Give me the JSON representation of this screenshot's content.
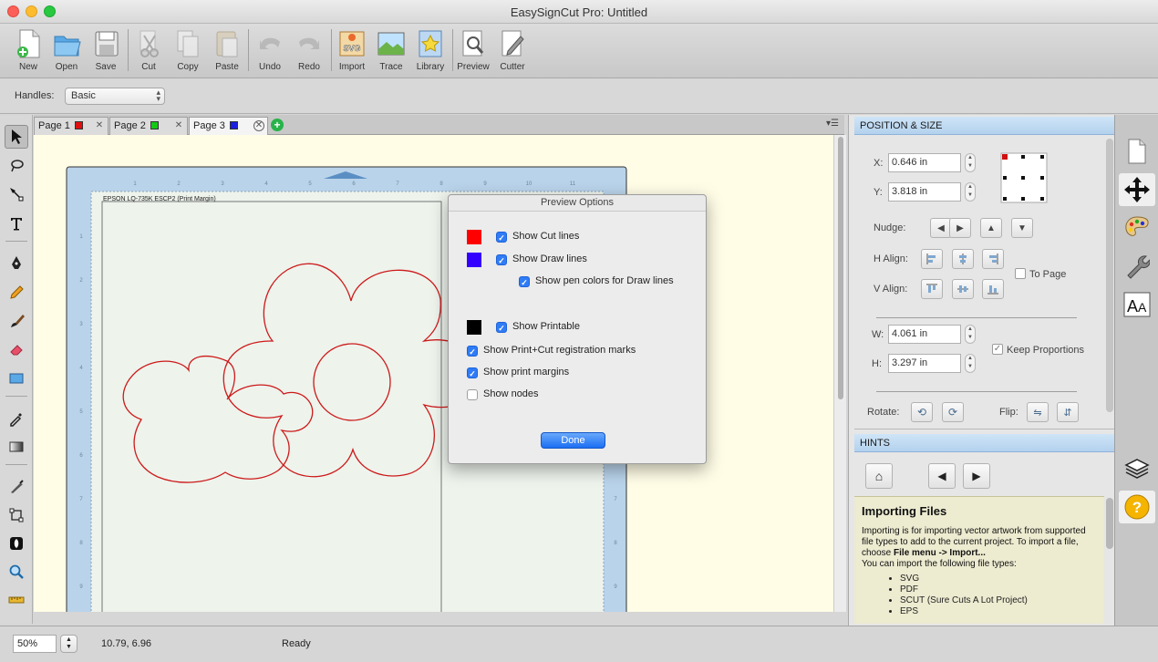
{
  "window": {
    "title": "EasySignCut Pro: Untitled"
  },
  "toolbar": {
    "new": "New",
    "open": "Open",
    "save": "Save",
    "cut": "Cut",
    "copy": "Copy",
    "paste": "Paste",
    "undo": "Undo",
    "redo": "Redo",
    "import": "Import",
    "trace": "Trace",
    "library": "Library",
    "preview": "Preview",
    "cutter": "Cutter",
    "import_badge": "SVG"
  },
  "handles": {
    "label": "Handles:",
    "value": "Basic"
  },
  "tabs": [
    {
      "label": "Page 1",
      "color": "#e01010"
    },
    {
      "label": "Page 2",
      "color": "#14c814"
    },
    {
      "label": "Page 3",
      "color": "#1d1de0"
    }
  ],
  "canvas": {
    "printer_label": "EPSON LQ-735K ESCP2 (Print Margin)",
    "ruler_top": [
      "1",
      "2",
      "3",
      "4",
      "5",
      "6",
      "7",
      "8",
      "9",
      "10",
      "11"
    ],
    "ruler_left": [
      "1",
      "2",
      "3",
      "4",
      "5",
      "6",
      "7",
      "8",
      "9"
    ]
  },
  "dialog": {
    "title": "Preview Options",
    "options": {
      "cut_lines": {
        "label": "Show Cut lines",
        "checked": true,
        "color": "#ff0000"
      },
      "draw_lines": {
        "label": "Show Draw lines",
        "checked": true,
        "color": "#3300ff"
      },
      "pen_colors": {
        "label": "Show pen colors for Draw lines",
        "checked": true
      },
      "printable": {
        "label": "Show Printable",
        "checked": true,
        "color": "#000000"
      },
      "registration": {
        "label": "Show Print+Cut registration marks",
        "checked": true
      },
      "print_margins": {
        "label": "Show print margins",
        "checked": true
      },
      "nodes": {
        "label": "Show nodes",
        "checked": false
      }
    },
    "done": "Done"
  },
  "position_size": {
    "header": "POSITION & SIZE",
    "x_label": "X:",
    "x_value": "0.646 in",
    "y_label": "Y:",
    "y_value": "3.818 in",
    "nudge_label": "Nudge:",
    "h_align_label": "H Align:",
    "v_align_label": "V Align:",
    "to_page": "To Page",
    "w_label": "W:",
    "w_value": "4.061 in",
    "h_label": "H:",
    "h_value": "3.297 in",
    "keep_proportions": "Keep Proportions",
    "rotate_label": "Rotate:",
    "flip_label": "Flip:"
  },
  "hints": {
    "header": "HINTS",
    "title": "Importing Files",
    "text_1": "Importing is for importing vector artwork from supported file types to add to the current project. To import a file, choose ",
    "text_bold": "File menu -> Import...",
    "text_2": "You can import the following file types:",
    "file_types": [
      "SVG",
      "PDF",
      "SCUT (Sure Cuts A Lot Project)",
      "EPS"
    ]
  },
  "status": {
    "zoom": "50%",
    "coords": "10.79, 6.96",
    "text": "Ready"
  },
  "colors": {
    "accent": "#2f7cf6",
    "cut_line": "#cc1a1a",
    "canvas_bg": "#fffde6",
    "mat_blue": "#b9d3ea"
  },
  "icons": [
    "pointer-icon",
    "lasso-icon",
    "node-edit-icon",
    "text-icon",
    "pen-icon",
    "pencil-icon",
    "brush-icon",
    "eraser-icon",
    "rectangle-icon",
    "eyedropper-icon",
    "gradient-icon",
    "knife-icon",
    "transform-icon",
    "contour-icon",
    "zoom-icon",
    "ruler-icon",
    "page-icon",
    "move-icon",
    "palette-icon",
    "wrench-icon",
    "text-size-icon",
    "layers-icon",
    "help-icon"
  ]
}
